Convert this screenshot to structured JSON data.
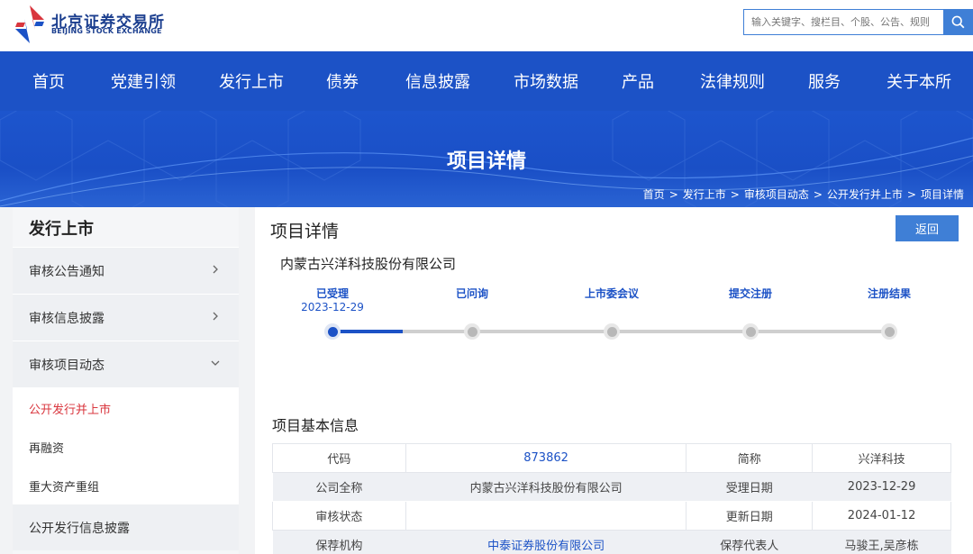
{
  "header": {
    "logo_cn": "北京证券交易所",
    "logo_en": "BEIJING STOCK EXCHANGE",
    "search_placeholder": "输入关键字、搜栏目、个股、公告、规则",
    "search_icon": "search-icon"
  },
  "nav": {
    "items": [
      "首页",
      "党建引领",
      "发行上市",
      "债券",
      "信息披露",
      "市场数据",
      "产品",
      "法律规则",
      "服务",
      "关于本所"
    ]
  },
  "banner": {
    "title": "项目详情",
    "breadcrumb": [
      "首页",
      "发行上市",
      "审核项目动态",
      "公开发行并上市",
      "项目详情"
    ],
    "separator": ">"
  },
  "sidebar": {
    "title": "发行上市",
    "items": [
      {
        "label": "审核公告通知",
        "icon": "chevron-right-icon"
      },
      {
        "label": "审核信息披露",
        "icon": "chevron-right-icon"
      },
      {
        "label": "审核项目动态",
        "icon": "chevron-down-icon"
      }
    ],
    "sub_items": [
      {
        "label": "公开发行并上市",
        "active": true
      },
      {
        "label": "再融资",
        "active": false
      },
      {
        "label": "重大资产重组",
        "active": false
      }
    ],
    "last_item": "公开发行信息披露"
  },
  "main": {
    "title": "项目详情",
    "back_label": "返回",
    "company": "内蒙古兴洋科技股份有限公司",
    "steps": [
      {
        "label": "已受理",
        "date": "2023-12-29",
        "done": true
      },
      {
        "label": "已问询",
        "date": "",
        "done": false
      },
      {
        "label": "上市委会议",
        "date": "",
        "done": false
      },
      {
        "label": "提交注册",
        "date": "",
        "done": false
      },
      {
        "label": "注册结果",
        "date": "",
        "done": false
      }
    ],
    "progress_fraction": 0.125,
    "section_title": "项目基本信息",
    "table": [
      [
        "代码",
        "873862",
        "简称",
        "兴洋科技"
      ],
      [
        "公司全称",
        "内蒙古兴洋科技股份有限公司",
        "受理日期",
        "2023-12-29"
      ],
      [
        "审核状态",
        "",
        "更新日期",
        "2024-01-12"
      ],
      [
        "保荐机构",
        "中泰证券股份有限公司",
        "保荐代表人",
        "马骏王,吴彦栋"
      ]
    ]
  },
  "colors": {
    "brand_blue": "#1c52c6",
    "accent_blue": "#3f7fd6",
    "active_red": "#d9363e"
  }
}
